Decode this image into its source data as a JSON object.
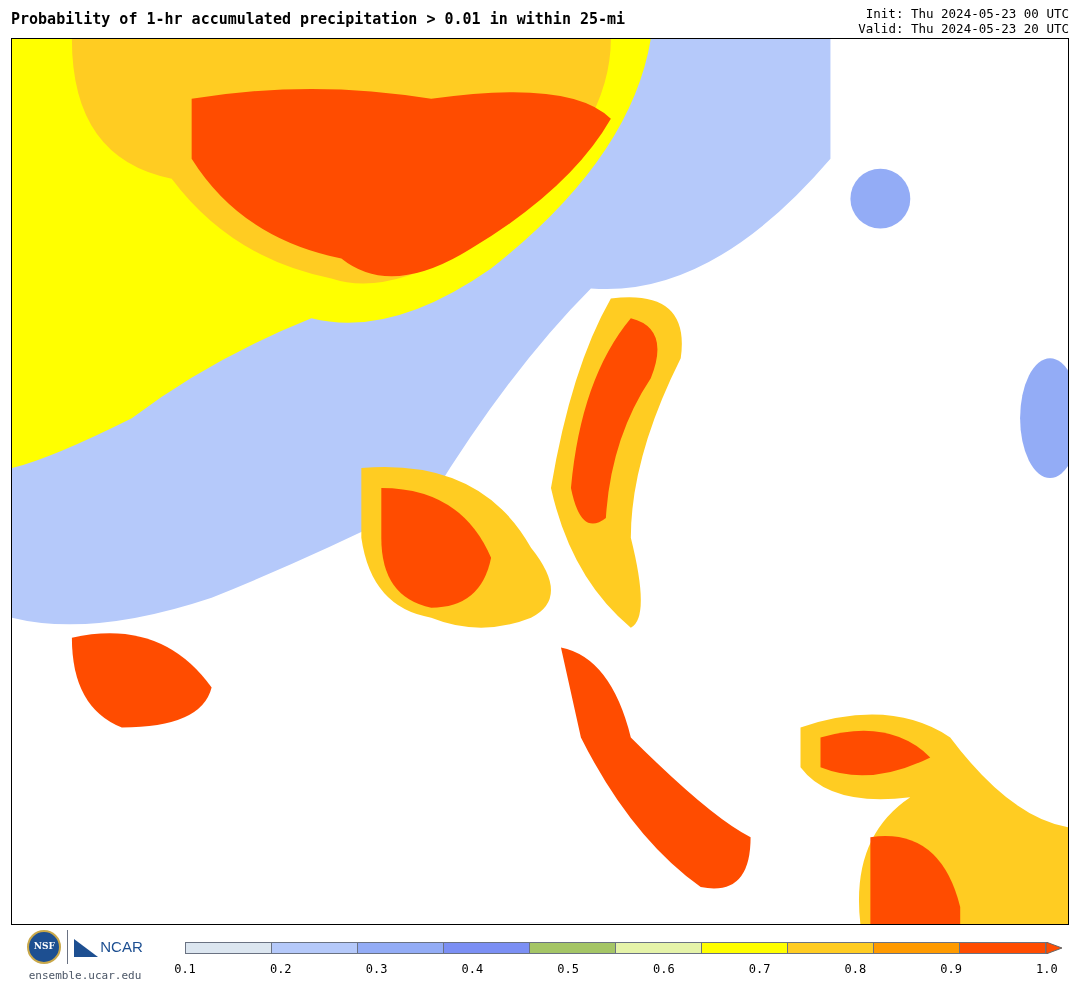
{
  "title": "Probability of 1-hr accumulated precipitation > 0.01 in within 25-mi",
  "init": "Init: Thu 2024-05-23 00 UTC",
  "valid": "Valid: Thu 2024-05-23 20 UTC",
  "logo": {
    "seal": "NSF",
    "name": "NCAR"
  },
  "site": "ensemble.ucar.edu",
  "colorbar": {
    "bins": [
      {
        "color": "#dce6f0"
      },
      {
        "color": "#b5c9fa"
      },
      {
        "color": "#93acf6"
      },
      {
        "color": "#7b8ff4"
      },
      {
        "color": "#a4c566"
      },
      {
        "color": "#e5f3a9"
      },
      {
        "color": "#ffff00"
      },
      {
        "color": "#ffcc22"
      },
      {
        "color": "#ff9a00"
      },
      {
        "color": "#ff4c00"
      }
    ],
    "labels": [
      "0.1",
      "0.2",
      "0.3",
      "0.4",
      "0.5",
      "0.6",
      "0.7",
      "0.8",
      "0.9",
      "1.0"
    ]
  }
}
